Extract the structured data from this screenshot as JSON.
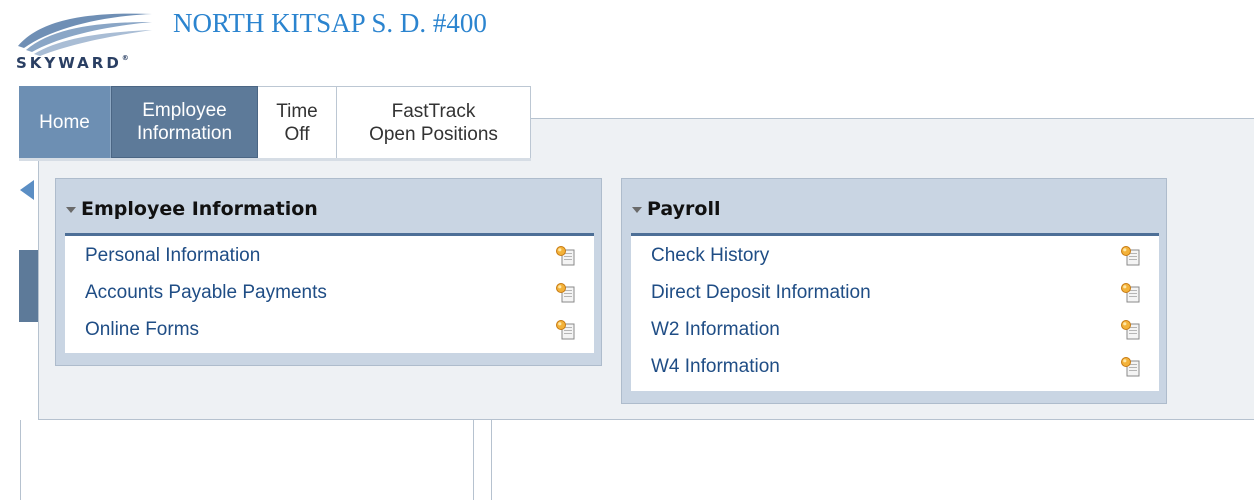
{
  "header": {
    "logo_text": "SKYWARD",
    "logo_tm": "®",
    "district_name": "NORTH KITSAP S. D. #400"
  },
  "tabs": [
    {
      "id": "home",
      "line1": "Home",
      "line2": ""
    },
    {
      "id": "employee-information",
      "line1": "Employee",
      "line2": "Information"
    },
    {
      "id": "time-off",
      "line1": "Time",
      "line2": "Off"
    },
    {
      "id": "fasttrack",
      "line1": "FastTrack",
      "line2": "Open Positions"
    }
  ],
  "cards": {
    "employee_information": {
      "title": "Employee Information",
      "items": [
        "Personal Information",
        "Accounts Payable Payments",
        "Online Forms"
      ]
    },
    "payroll": {
      "title": "Payroll",
      "items": [
        "Check History",
        "Direct Deposit Information",
        "W2 Information",
        "W4 Information"
      ]
    }
  },
  "icons": {
    "item_action": "favorite-add-icon",
    "collapse": "caret-down-icon"
  },
  "colors": {
    "accent": "#2b84cf",
    "tab_active": "#5d7a99",
    "link": "#1f4d85",
    "card_bg": "#c9d5e3"
  }
}
